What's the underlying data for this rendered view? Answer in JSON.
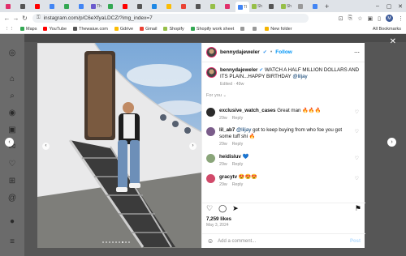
{
  "browser": {
    "url": "instagram.com/p/C6eXfyaLDCZ/?img_index=7",
    "tab_labels": [
      "",
      "",
      "",
      "",
      "",
      "",
      "Th",
      "",
      "",
      "",
      "",
      "",
      "",
      "",
      "",
      "",
      "Tl",
      "Sh",
      "",
      "Sh",
      "",
      ""
    ],
    "bookmarks": [
      {
        "label": "Maps",
        "color": "#34a853"
      },
      {
        "label": "YouTube",
        "color": "#ff0000"
      },
      {
        "label": "Thewaiue.com",
        "color": "#555555"
      },
      {
        "label": "Gdrive",
        "color": "#fbbc04"
      },
      {
        "label": "Gmail",
        "color": "#ea4335"
      },
      {
        "label": "Shopify",
        "color": "#96bf48"
      },
      {
        "label": "Shopify work sheet",
        "color": "#34a853"
      },
      {
        "label": "",
        "color": "#999999"
      },
      {
        "label": "",
        "color": "#999999"
      },
      {
        "label": "New folder",
        "color": "#f4b400"
      }
    ],
    "all_bookmarks": "All Bookmarks"
  },
  "post": {
    "username": "bennydajeweler",
    "follow_label": "Follow",
    "caption_user": "bennydajeweler",
    "caption_text": "WATCH A HALF MILLION DOLLARS AND ITS PLAIN...HAPPY BIRTHDAY",
    "caption_mention": "@liljay",
    "caption_meta": "Edited · 49w",
    "for_you": "For you",
    "comments": [
      {
        "user": "exclusive_watch_cases",
        "text": "Great man 🔥🔥🔥",
        "age": "29w",
        "reply": "Reply",
        "avatar_color": "#2b2b2b"
      },
      {
        "user": "lil_ab7",
        "mention": "@liljay",
        "text": "got to keep buying from who foe you got some tuff shi 🔥",
        "age": "29w",
        "reply": "Reply",
        "avatar_color": "#7a5c8a"
      },
      {
        "user": "heidisluv",
        "text": "💙",
        "age": "29w",
        "reply": "Reply",
        "avatar_color": "#8aa57a"
      },
      {
        "user": "gracytv",
        "text": "😍😍😍",
        "age": "29w",
        "reply": "Reply",
        "avatar_color": "#d14a6a"
      }
    ],
    "likes": "7,259 likes",
    "date": "May 3, 2024",
    "add_comment_placeholder": "Add a comment...",
    "post_label": "Post"
  }
}
